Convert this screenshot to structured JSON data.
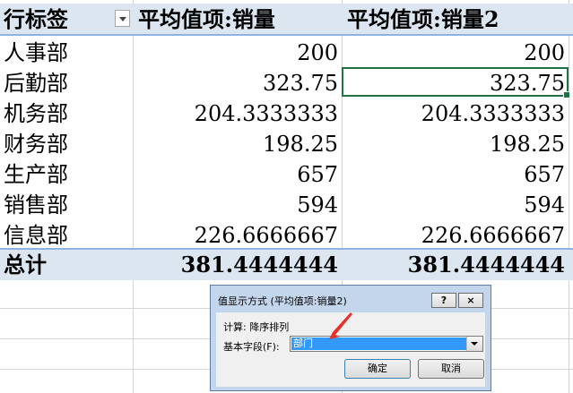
{
  "table": {
    "header": {
      "row_label": "行标签",
      "col1": "平均值项:销量",
      "col2": "平均值项:销量2"
    },
    "rows": [
      {
        "label": "人事部",
        "v1": "200",
        "v2": "200"
      },
      {
        "label": "后勤部",
        "v1": "323.75",
        "v2": "323.75"
      },
      {
        "label": "机务部",
        "v1": "204.3333333",
        "v2": "204.3333333"
      },
      {
        "label": "财务部",
        "v1": "198.25",
        "v2": "198.25"
      },
      {
        "label": "生产部",
        "v1": "657",
        "v2": "657"
      },
      {
        "label": "销售部",
        "v1": "594",
        "v2": "594"
      },
      {
        "label": "信息部",
        "v1": "226.6666667",
        "v2": "226.6666667"
      }
    ],
    "total": {
      "label": "总计",
      "v1": "381.4444444",
      "v2": "381.4444444"
    }
  },
  "dialog": {
    "title": "值显示方式 (平均值项:销量2)",
    "help": "?",
    "close": "×",
    "calc": "计算: 降序排列",
    "field_label": "基本字段(F):",
    "field_value": "部门",
    "ok": "确定",
    "cancel": "取消"
  },
  "colors": {
    "header_bg": "#dce6f1",
    "selection": "#217346",
    "dialog_frame": "#c4d6ec",
    "arrow": "#e8302a"
  }
}
